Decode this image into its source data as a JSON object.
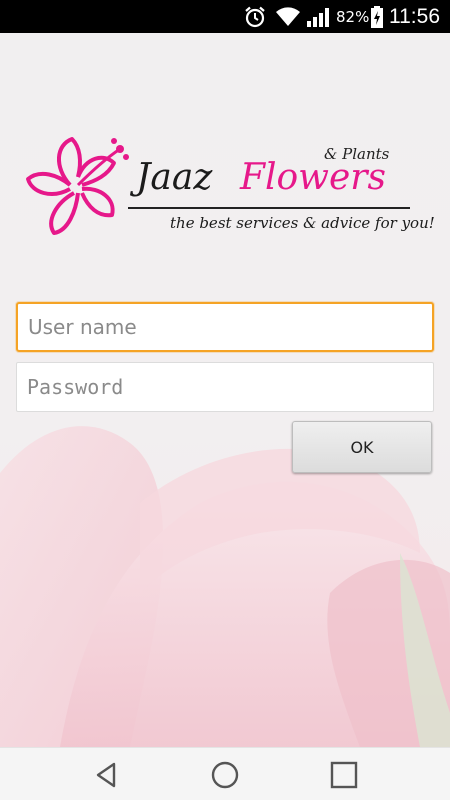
{
  "status_bar": {
    "battery_percent": "82%",
    "time": "11:56",
    "icons": [
      "alarm-icon",
      "wifi-icon",
      "signal-icon",
      "battery-charging-icon"
    ]
  },
  "brand": {
    "name_part1": "Jaaz",
    "name_part2": "Flowers",
    "subtitle": "& Plants",
    "tagline": "the best services & advice for you!",
    "logo_icon": "hibiscus-flower-icon",
    "accent_color": "#e6188a"
  },
  "form": {
    "username": {
      "placeholder": "User name",
      "value": ""
    },
    "password": {
      "placeholder": "Password",
      "value": ""
    },
    "ok_label": "OK",
    "focus_color": "#f5a325"
  },
  "nav_bar": {
    "buttons": [
      "back-icon",
      "home-icon",
      "recent-apps-icon"
    ]
  }
}
